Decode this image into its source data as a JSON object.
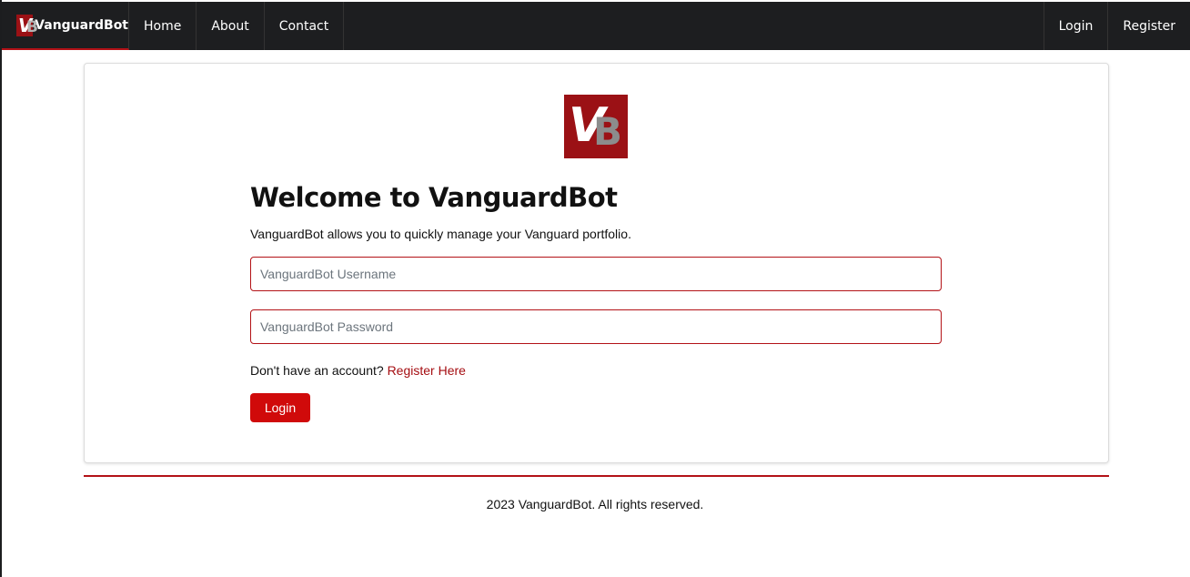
{
  "navbar": {
    "brand": {
      "logo_letters": "VB",
      "name": "VanguardBot"
    },
    "links": [
      {
        "label": "Home"
      },
      {
        "label": "About"
      },
      {
        "label": "Contact"
      }
    ],
    "right_links": [
      {
        "label": "Login"
      },
      {
        "label": "Register"
      }
    ]
  },
  "main": {
    "logo": {
      "v": "V",
      "b": "B"
    },
    "title": "Welcome to VanguardBot",
    "subtitle": "VanguardBot allows you to quickly manage your Vanguard portfolio.",
    "username_placeholder": "VanguardBot Username",
    "password_placeholder": "VanguardBot Password",
    "signup_prompt": "Don't have an account?",
    "signup_link": "Register Here",
    "login_button": "Login"
  },
  "footer": {
    "text": "2023 VanguardBot. All rights reserved."
  },
  "colors": {
    "accent": "#b31217",
    "button": "#d00a0a",
    "navbar_bg": "#1d1e20",
    "logo_bg": "#9b1115"
  }
}
